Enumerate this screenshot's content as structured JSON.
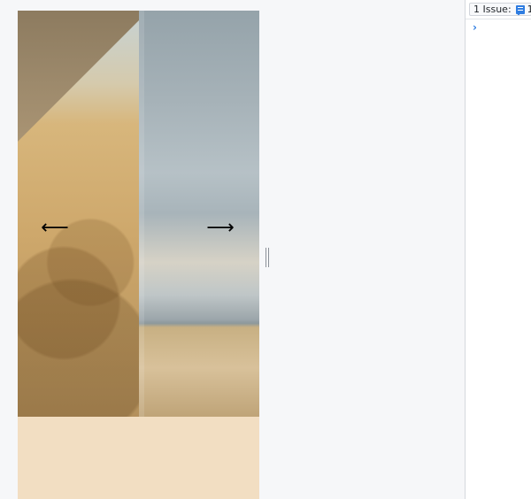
{
  "viewport": {
    "left_arrow": "⟵",
    "right_arrow": "⟶"
  },
  "devtools": {
    "issues_label": "1 Issue:",
    "issues_count": "1",
    "console_prompt": "›"
  },
  "icons": {
    "resize_handle": "resize-handle-icon",
    "issues": "issues-icon"
  },
  "colors": {
    "page_background": "#f6f7f9",
    "viewport_background": "#f2dec2",
    "accent": "#2f7de1"
  }
}
